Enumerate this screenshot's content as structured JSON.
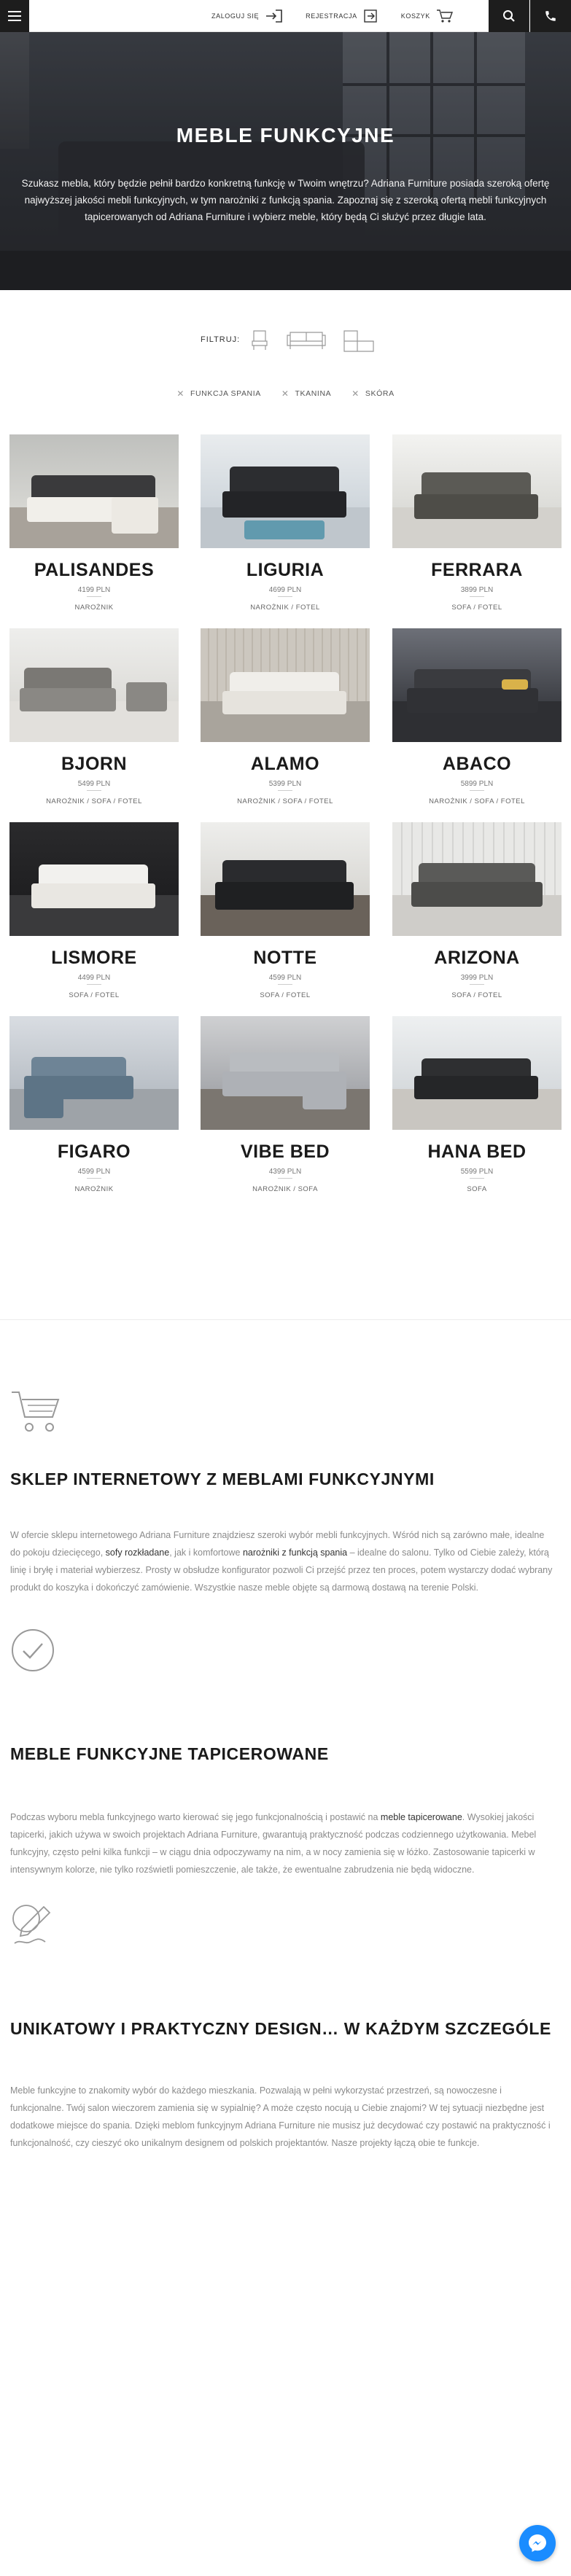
{
  "topbar": {
    "login_label": "ZALOGUJ SIĘ",
    "register_label": "REJESTRACJA",
    "cart_label": "KOSZYK"
  },
  "hero": {
    "title": "MEBLE FUNKCYJNE",
    "description": "Szukasz mebla, który będzie pełnił bardzo konkretną funkcję w Twoim wnętrzu? Adriana Furniture posiada szeroką ofertę najwyższej jakości mebli funkcyjnych, w tym narożniki z funkcją spania. Zapoznaj się z szeroką ofertą mebli funkcyjnych tapicerowanych od Adriana Furniture i wybierz meble, który będą Ci służyć przez długie lata."
  },
  "filter": {
    "label": "FILTRUJ:",
    "active_tags": [
      "FUNKCJA SPANIA",
      "TKANINA",
      "SKÓRA"
    ]
  },
  "products": [
    {
      "name": "PALISANDES",
      "price": "4199 PLN",
      "category": "NAROŻNIK"
    },
    {
      "name": "LIGURIA",
      "price": "4699 PLN",
      "category": "NAROŻNIK / FOTEL"
    },
    {
      "name": "FERRARA",
      "price": "3899 PLN",
      "category": "SOFA / FOTEL"
    },
    {
      "name": "BJORN",
      "price": "5499 PLN",
      "category": "NAROŻNIK / SOFA / FOTEL"
    },
    {
      "name": "ALAMO",
      "price": "5399 PLN",
      "category": "NAROŻNIK / SOFA / FOTEL"
    },
    {
      "name": "ABACO",
      "price": "5899 PLN",
      "category": "NAROŻNIK / SOFA / FOTEL"
    },
    {
      "name": "LISMORE",
      "price": "4499 PLN",
      "category": "SOFA / FOTEL"
    },
    {
      "name": "NOTTE",
      "price": "4599 PLN",
      "category": "SOFA / FOTEL"
    },
    {
      "name": "ARIZONA",
      "price": "3999 PLN",
      "category": "SOFA / FOTEL"
    },
    {
      "name": "FIGARO",
      "price": "4599 PLN",
      "category": "NAROŻNIK"
    },
    {
      "name": "VIBE BED",
      "price": "4399 PLN",
      "category": "NAROŻNIK / SOFA"
    },
    {
      "name": "HANA BED",
      "price": "5599 PLN",
      "category": "SOFA"
    }
  ],
  "info_sections": [
    {
      "icon": "cart-icon",
      "title": "SKLEP INTERNETOWY Z MEBLAMI FUNKCYJNYMI",
      "text_1": "W ofercie sklepu internetowego Adriana Furniture znajdziesz szeroki wybór mebli funkcyjnych. Wśród nich są zarówno małe, idealne do pokoju dziecięcego, ",
      "link_1": "sofy rozkładane",
      "text_2": ", jak i komfortowe ",
      "link_2": "narożniki z funkcją spania",
      "text_3": " – idealne do salonu. Tylko od Ciebie zależy, którą linię i bryłę i materiał wybierzesz. Prosty w obsłudze konfigurator pozwoli Ci przejść przez ten proces, potem wystarczy dodać wybrany produkt do koszyka i dokończyć zamówienie. Wszystkie nasze meble objęte są darmową dostawą na terenie Polski."
    },
    {
      "icon": "check-circle-icon",
      "title": "MEBLE FUNKCYJNE TAPICEROWANE",
      "text_1": "Podczas wyboru mebla funkcyjnego warto kierować się jego funkcjonalnością i postawić na ",
      "link_1": "meble tapicerowane",
      "text_2": ". Wysokiej jakości tapicerki, jakich używa w swoich projektach Adriana Furniture, gwarantują praktyczność podczas codziennego użytkowania. Mebel funkcyjny, często pełni kilka funkcji – w ciągu dnia odpoczywamy na nim, a w nocy zamienia się w łóżko. Zastosowanie tapicerki w intensywnym kolorze, nie tylko rozświetli pomieszczenie, ale także, że ewentualne zabrudzenia nie będą widoczne."
    },
    {
      "icon": "pencil-design-icon",
      "title": "UNIKATOWY I PRAKTYCZNY DESIGN… W KAŻDYM SZCZEGÓLE",
      "text_1": "Meble funkcyjne to znakomity wybór do każdego mieszkania. Pozwalają w pełni wykorzystać przestrzeń, są nowoczesne i funkcjonalne. Twój salon wieczorem zamienia się w sypialnię? A może często nocują u Ciebie znajomi? W tej sytuacji niezbędne jest dodatkowe miejsce do spania. Dzięki meblom funkcyjnym Adriana Furniture nie musisz już decydować czy postawić na praktyczność i funkcjonalność, czy cieszyć oko unikalnym designem od polskich projektantów. Nasze projekty łączą obie te funkcje."
    }
  ]
}
